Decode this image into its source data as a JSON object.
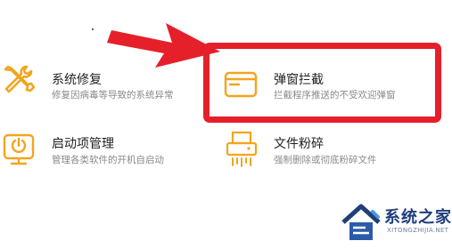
{
  "tools": [
    {
      "title": "系统修复",
      "desc": "修复因病毒等导致的系统异常",
      "icon": "wrench-screwdriver-icon"
    },
    {
      "title": "弹窗拦截",
      "desc": "拦截程序推送的不受欢迎弹窗",
      "icon": "popup-window-icon"
    },
    {
      "title": "启动项管理",
      "desc": "管理各类软件的开机自启动",
      "icon": "startup-monitor-icon"
    },
    {
      "title": "文件粉碎",
      "desc": "强制删除或彻底粉碎文件",
      "icon": "shredder-icon"
    }
  ],
  "watermark": {
    "name": "系统之家",
    "url": "XITONGZHIJIA.NET"
  },
  "colors": {
    "accent": "#f2a51e",
    "highlight": "#e5202a",
    "brand": "#1f3e7a"
  }
}
